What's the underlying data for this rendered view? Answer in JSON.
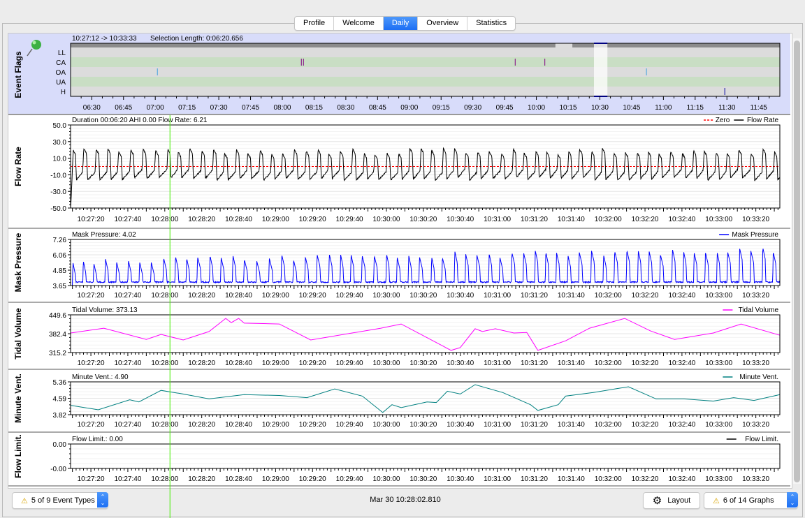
{
  "tabs": [
    {
      "label": "Profile"
    },
    {
      "label": "Welcome"
    },
    {
      "label": "Daily",
      "active": true
    },
    {
      "label": "Overview"
    },
    {
      "label": "Statistics"
    }
  ],
  "event_flags": {
    "title": "Event Flags",
    "range_text": "10:27:12 -> 10:33:33",
    "selection_text": "Selection Length: 0:06:20.656",
    "pin_icon": "green-pushpin-icon",
    "rows": [
      "LL",
      "CA",
      "OA",
      "UA",
      "H"
    ],
    "x_ticks": [
      "06:30",
      "06:45",
      "07:00",
      "07:15",
      "07:30",
      "07:45",
      "08:00",
      "08:15",
      "08:30",
      "08:45",
      "09:00",
      "09:15",
      "09:30",
      "09:45",
      "10:00",
      "10:15",
      "10:30",
      "10:45",
      "11:00",
      "11:15",
      "11:30",
      "11:45"
    ],
    "x_range": [
      "06:20",
      "11:55"
    ],
    "session_gap": [
      "10:09",
      "10:17"
    ],
    "selection": [
      "10:27:12",
      "10:33:33"
    ],
    "events": [
      {
        "type": "CA",
        "time": "08:09",
        "color": "#800080"
      },
      {
        "type": "CA",
        "time": "08:10",
        "color": "#800080"
      },
      {
        "type": "CA",
        "time": "09:50",
        "color": "#800080"
      },
      {
        "type": "CA",
        "time": "10:04",
        "color": "#800080"
      },
      {
        "type": "OA",
        "time": "07:01",
        "color": "#40a0e0"
      },
      {
        "type": "OA",
        "time": "10:52",
        "color": "#40a0e0"
      },
      {
        "type": "H",
        "time": "11:29",
        "color": "#0000a0"
      }
    ],
    "colors": {
      "row_gray": "#dcdcdc",
      "row_green": "#c9dec4",
      "header_bar": "#8c8c8c",
      "selection": "#ffffff",
      "selection_marker": "#0000ff",
      "panel_bg": "#d8dcfa"
    }
  },
  "time_axis": {
    "ticks": [
      "10:27:20",
      "10:27:40",
      "10:28:00",
      "10:28:20",
      "10:28:40",
      "10:29:00",
      "10:29:20",
      "10:29:40",
      "10:30:00",
      "10:30:20",
      "10:30:40",
      "10:31:00",
      "10:31:20",
      "10:31:40",
      "10:32:00",
      "10:32:20",
      "10:32:40",
      "10:33:00",
      "10:33:20"
    ],
    "range": [
      "10:27:09",
      "10:33:33"
    ],
    "cursor": "10:28:02.810",
    "cursor_color": "#44ee00"
  },
  "chart_data": [
    {
      "type": "line",
      "title": "Flow Rate",
      "header": "Duration 00:06:20 AHI 0.00 Flow Rate: 6.21",
      "y_ticks": [
        "50.0",
        "30.0",
        "10.0",
        "-10.0",
        "-30.0",
        "-50.0"
      ],
      "ylim": [
        -50,
        50
      ],
      "legend": [
        {
          "name": "Zero",
          "color": "#ff0000",
          "dashed": true
        },
        {
          "name": "Flow Rate",
          "color": "#000000"
        }
      ],
      "waveform": "breathing"
    },
    {
      "type": "line",
      "title": "Mask Pressure",
      "header": "Mask Pressure: 4.02",
      "y_ticks": [
        "7.26",
        "6.06",
        "4.85",
        "3.65"
      ],
      "ylim": [
        3.65,
        7.26
      ],
      "legend": [
        {
          "name": "Mask Pressure",
          "color": "#0000ff"
        }
      ],
      "waveform": "pressure"
    },
    {
      "type": "line",
      "title": "Tidal Volume",
      "header": "Tidal Volume: 373.13",
      "y_ticks": [
        "449.6",
        "382.4",
        "315.2"
      ],
      "ylim": [
        315.2,
        449.6
      ],
      "legend": [
        {
          "name": "Tidal Volume",
          "color": "#ff00ff"
        }
      ],
      "points": [
        [
          "10:27:09",
          385
        ],
        [
          "10:27:27",
          402
        ],
        [
          "10:27:50",
          362
        ],
        [
          "10:27:58",
          380
        ],
        [
          "10:28:10",
          360
        ],
        [
          "10:28:24",
          390
        ],
        [
          "10:28:33",
          437
        ],
        [
          "10:28:36",
          422
        ],
        [
          "10:28:40",
          437
        ],
        [
          "10:28:43",
          420
        ],
        [
          "10:29:02",
          417
        ],
        [
          "10:29:19",
          360
        ],
        [
          "10:29:57",
          402
        ],
        [
          "10:30:08",
          417
        ],
        [
          "10:30:35",
          323
        ],
        [
          "10:30:40",
          333
        ],
        [
          "10:30:48",
          400
        ],
        [
          "10:30:52",
          390
        ],
        [
          "10:30:59",
          400
        ],
        [
          "10:31:09",
          385
        ],
        [
          "10:31:16",
          387
        ],
        [
          "10:31:22",
          323
        ],
        [
          "10:31:37",
          357
        ],
        [
          "10:31:50",
          402
        ],
        [
          "10:32:09",
          437
        ],
        [
          "10:32:23",
          392
        ],
        [
          "10:32:36",
          362
        ],
        [
          "10:32:57",
          385
        ],
        [
          "10:33:12",
          417
        ],
        [
          "10:33:33",
          377
        ]
      ]
    },
    {
      "type": "line",
      "title": "Minute Vent.",
      "header": "Minute Vent.: 4.90",
      "y_ticks": [
        "5.36",
        "4.59",
        "3.82"
      ],
      "ylim": [
        3.82,
        5.36
      ],
      "legend": [
        {
          "name": "Minute Vent.",
          "color": "#008080"
        }
      ],
      "points": [
        [
          "10:27:09",
          4.26
        ],
        [
          "10:27:24",
          4.05
        ],
        [
          "10:27:41",
          4.52
        ],
        [
          "10:27:46",
          4.42
        ],
        [
          "10:27:58",
          4.96
        ],
        [
          "10:28:10",
          4.79
        ],
        [
          "10:28:24",
          4.56
        ],
        [
          "10:28:43",
          4.76
        ],
        [
          "10:29:02",
          4.72
        ],
        [
          "10:29:17",
          4.62
        ],
        [
          "10:29:32",
          5.03
        ],
        [
          "10:29:47",
          4.69
        ],
        [
          "10:29:58",
          3.92
        ],
        [
          "10:30:03",
          4.29
        ],
        [
          "10:30:08",
          4.15
        ],
        [
          "10:30:22",
          4.42
        ],
        [
          "10:30:27",
          4.39
        ],
        [
          "10:30:33",
          4.92
        ],
        [
          "10:30:40",
          4.79
        ],
        [
          "10:30:48",
          5.23
        ],
        [
          "10:31:03",
          4.86
        ],
        [
          "10:31:18",
          4.29
        ],
        [
          "10:31:22",
          4.02
        ],
        [
          "10:31:33",
          4.29
        ],
        [
          "10:31:37",
          4.69
        ],
        [
          "10:31:52",
          4.86
        ],
        [
          "10:32:11",
          5.13
        ],
        [
          "10:32:26",
          4.56
        ],
        [
          "10:32:41",
          4.56
        ],
        [
          "10:32:57",
          4.46
        ],
        [
          "10:33:08",
          4.62
        ],
        [
          "10:33:19",
          4.49
        ],
        [
          "10:33:33",
          4.76
        ]
      ]
    },
    {
      "type": "line",
      "title": "Flow Limit.",
      "header": "Flow Limit.: 0.00",
      "y_ticks": [
        "0.00",
        "-0.00"
      ],
      "ylim": [
        -0.001,
        0.001
      ],
      "legend": [
        {
          "name": "Flow Limit.",
          "color": "#000000"
        }
      ],
      "points": []
    }
  ],
  "bottom": {
    "event_types": "5 of 9 Event Types",
    "date": "Mar 30 10:28:02.810",
    "layout": "Layout",
    "graphs": "6 of 14 Graphs",
    "warning_icon": "warning-icon",
    "gear_icon": "gear-icon"
  }
}
